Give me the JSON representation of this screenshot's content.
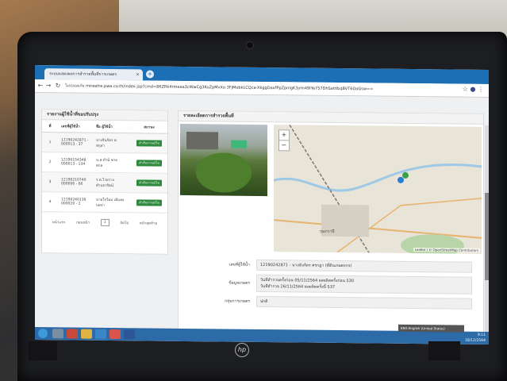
{
  "browser": {
    "tab_title": "ระบบแสดงผลการสำรวจพื้นที่การเกษตร",
    "tab_close": "×",
    "new_tab": "+",
    "url_warning": "ไม่ปลอดภัย",
    "url": "mireatre.pwa.co.th/index.jsp?cmd=8KZRk4rmeaa3cWwCg3KuZpMvXo 3FjMobkLCQca-XkggDaxfPpZpnlgK3jrrn49lYe757DhSattlbqBVT6OoGsw==",
    "back": "←",
    "forward": "→",
    "reload": "↻",
    "home": "⌂",
    "star": "☆",
    "profile": "●",
    "menu": "⋮"
  },
  "left_panel": {
    "title": "รายงานผู้ใช้น้ำที่ขอปรับปรุง",
    "headers": [
      "ที่",
      "เลขที่ผู้ใช้น้ำ",
      "ชื่อ ผู้ใช้น้ำ",
      "สถานะ"
    ],
    "rows": [
      {
        "no": "1",
        "id": "12190242871 -\n000013 - 37",
        "name": "นางจันร์ตร ค\nสกุลา",
        "status": "สำเร็จการแก้ไข"
      },
      {
        "no": "2",
        "id": "12190154348\n000013 - 134",
        "name": "น.ส.ทำนั่ ชาย\nสกล",
        "status": "สำเร็จการแก้ไข"
      },
      {
        "no": "3",
        "id": "12190210740\n000006 - 66",
        "name": "ร.ต.ไวยวาง\nตำบลวรัตน์",
        "status": "สำเร็จการแก้ไข"
      },
      {
        "no": "4",
        "id": "12190240136\n000020 - 2",
        "name": "นายใจใหม่ เมืองพ\nบพรา",
        "status": "สำเร็จการแก้ไข"
      }
    ],
    "pager": {
      "prev": "หน้าแรก",
      "prev2": "ก่อนหน้า",
      "current": "1",
      "next": "ถัดไป",
      "last": "หน้าสุดท้าย"
    }
  },
  "right_panel": {
    "title": "รายละเอียดการสำรวจพื้นที่",
    "map_zoom_in": "+",
    "map_zoom_out": "−",
    "map_place": "กุมภวาปี",
    "map_attrib": "Leaflet | © OpenStreetMap Contributors",
    "form": {
      "user_label": "เลขที่ผู้ใช้น้ำ",
      "user_value": "12190242871 - นางจันร์ตร ศรกฎา (ที่ดินเกษตรกร)",
      "info_label": "ข้อมูลเกษตร",
      "info_line1": "วันที่สำรวจครั้งก่อน  05/11/2564  ผลผลิตครั้งก่อน  530",
      "info_line2": "วันที่สำรวจ  26/11/2564  ผลผลิตครั้งนี้  537",
      "type_label": "กลุ่มการเกษตร",
      "type_value": "ปกติ"
    }
  },
  "taskbar": {
    "language": "ENG English (United States)",
    "time": "9:11",
    "date": "16/12/2564"
  },
  "laptop": {
    "brand": "hp"
  }
}
